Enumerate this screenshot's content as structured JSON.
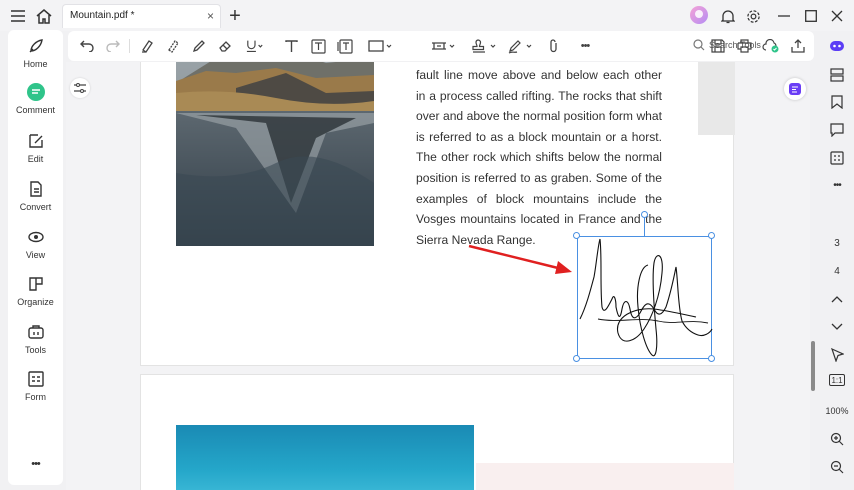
{
  "window": {
    "tab_title": "Mountain.pdf *",
    "tab_close": "×",
    "new_tab": "+"
  },
  "left_rail": {
    "items": [
      {
        "label": "Home",
        "icon": "rocket-icon"
      },
      {
        "label": "Comment",
        "icon": "comment-icon"
      },
      {
        "label": "Edit",
        "icon": "edit-icon"
      },
      {
        "label": "Convert",
        "icon": "convert-icon"
      },
      {
        "label": "View",
        "icon": "view-icon"
      },
      {
        "label": "Organize",
        "icon": "organize-icon"
      },
      {
        "label": "Tools",
        "icon": "tools-icon"
      },
      {
        "label": "Form",
        "icon": "form-icon"
      }
    ],
    "more": "•••"
  },
  "toolbar": {
    "search_label": "Search Tools",
    "more": "•••"
  },
  "right_rail": {
    "page_current": "3",
    "page_next": "4",
    "zoom": "100%",
    "fit_label": "1:1"
  },
  "document": {
    "paragraph": "fault line move above and below each other in a process called rifting. The rocks that shift over and above the normal position form what is referred to as a block mountain or a horst. The other rock which shifts below the normal position is referred to as graben. Some of the examples of block mountains include the Vosges mountains located in France and the Sierra Nevada Range."
  },
  "colors": {
    "accent": "#4a90e2",
    "arrow": "#e02020",
    "comment_active": "#2fc48a"
  }
}
